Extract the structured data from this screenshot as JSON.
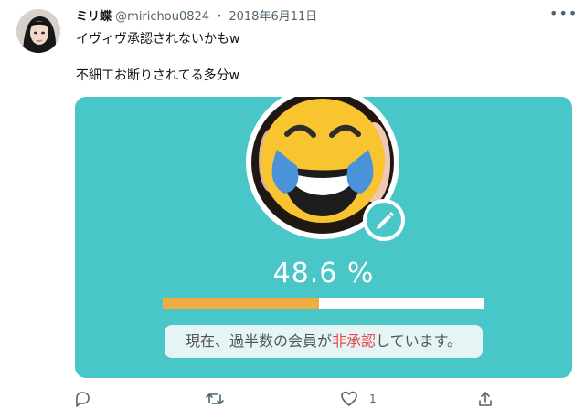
{
  "tweet": {
    "display_name": "ミリ蝶",
    "handle": "@mirichou0824",
    "separator": "・",
    "date": "2018年6月11日",
    "text": "イヴィヴ承認されないかもw\n\n不細工お断りされてる多分w",
    "more_icon": "more-horizontal-icon"
  },
  "card": {
    "percent_text": "48.6 %",
    "progress_fraction": 0.486,
    "status_prefix": "現在、過半数の会員が",
    "status_emphasis": "非承認",
    "status_suffix": "しています。",
    "colors": {
      "background": "#48c6c8",
      "progress": "#efad43",
      "emphasis": "#e34b4b"
    }
  },
  "actions": {
    "reply_icon": "reply-icon",
    "retweet_icon": "retweet-icon",
    "like_icon": "heart-icon",
    "like_count": "1",
    "share_icon": "share-icon"
  }
}
